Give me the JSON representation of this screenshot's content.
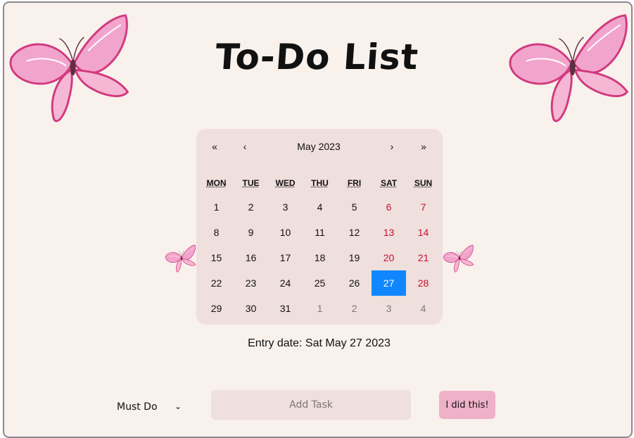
{
  "page": {
    "title": "To-Do List",
    "entry_label": "Entry date: Sat May 27 2023"
  },
  "calendar": {
    "nav": {
      "prev_year": "«",
      "prev_month": "‹",
      "month_label": "May 2023",
      "next_month": "›",
      "next_year": "»"
    },
    "weekdays": [
      "MON",
      "TUE",
      "WED",
      "THU",
      "FRI",
      "SAT",
      "SUN"
    ],
    "days": [
      [
        "1",
        "2",
        "3",
        "4",
        "5",
        "6",
        "7"
      ],
      [
        "8",
        "9",
        "10",
        "11",
        "12",
        "13",
        "14"
      ],
      [
        "15",
        "16",
        "17",
        "18",
        "19",
        "20",
        "21"
      ],
      [
        "22",
        "23",
        "24",
        "25",
        "26",
        "27",
        "28"
      ],
      [
        "29",
        "30",
        "31",
        "1",
        "2",
        "3",
        "4"
      ]
    ],
    "selected_day": "27",
    "colors": {
      "background": "#efdfdd",
      "selected": "#1087ff",
      "weekend": "#c8102e",
      "neighbor": "#7a7a7a"
    }
  },
  "form": {
    "category_value": "Must Do",
    "task_placeholder": "Add Task",
    "task_value": "",
    "submit_label": "I did this!"
  },
  "decorations": {
    "icon": "butterfly-icon",
    "pink": "#ec8fbf",
    "deep_pink": "#d1397e"
  }
}
